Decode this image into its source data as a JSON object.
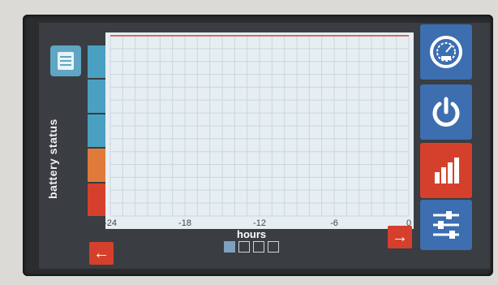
{
  "chart_data": {
    "type": "line",
    "xlabel": "hours",
    "ylabel": "battery status",
    "x_ticks": [
      "-24",
      "-18",
      "-12",
      "-6",
      "0"
    ],
    "series": [
      {
        "x": [
          -24,
          0
        ],
        "y": [
          100,
          100
        ]
      }
    ],
    "xlim": [
      -24,
      0
    ],
    "ylim": [
      0,
      100
    ],
    "grid": true,
    "colors": {
      "line": "#c7403a"
    },
    "battery_scale_colors": [
      "#4aa0c0",
      "#4aa0c0",
      "#4aa0c0",
      "#e07a3a",
      "#d5402c"
    ]
  },
  "nav": {
    "prev_arrow": "←",
    "next_arrow": "→",
    "page_indicator": {
      "pages": 4,
      "active": 1
    }
  },
  "sidebar": {
    "buttons": [
      {
        "name": "gauge-button",
        "icon": "gauge-icon",
        "color": "#3c6eb0"
      },
      {
        "name": "power-button",
        "icon": "power-icon",
        "color": "#3c6eb0"
      },
      {
        "name": "chart-button",
        "icon": "bar-chart-icon",
        "color": "#d5402c"
      },
      {
        "name": "settings-button",
        "icon": "sliders-icon",
        "color": "#3c6eb0"
      }
    ]
  },
  "menu_icon": "document-icon"
}
